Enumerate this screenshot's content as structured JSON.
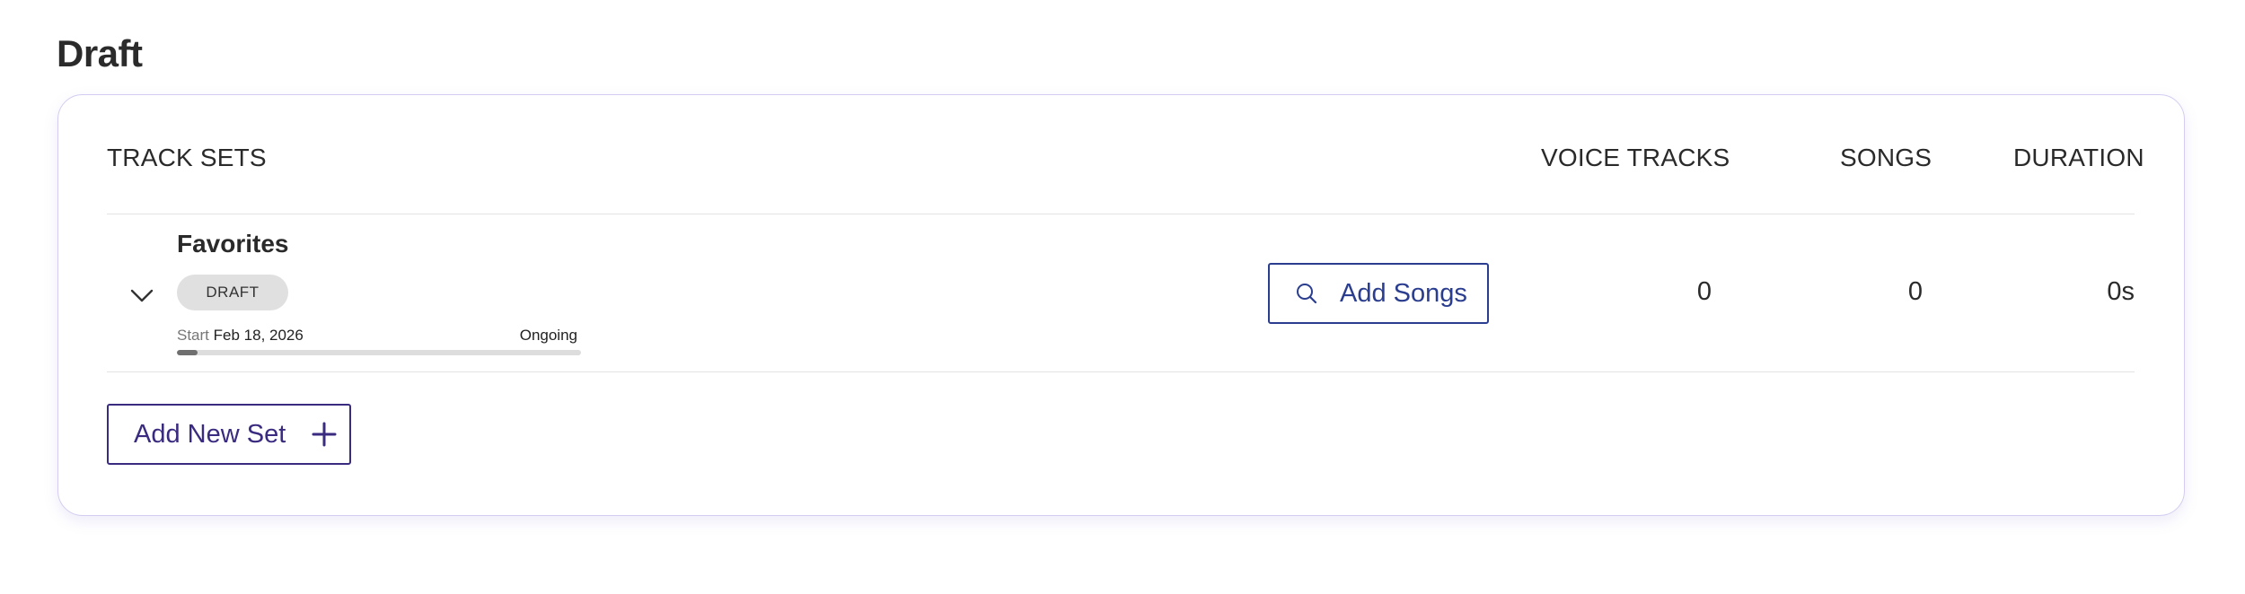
{
  "page": {
    "title": "Draft"
  },
  "table": {
    "headers": {
      "track_sets": "TRACK SETS",
      "voice_tracks": "VOICE TRACKS",
      "songs": "SONGS",
      "duration": "DURATION"
    },
    "rows": [
      {
        "name": "Favorites",
        "status": "DRAFT",
        "start_label": "Start",
        "start_date": "Feb 18, 2026",
        "end_label": "Ongoing",
        "progress_fraction": 0.05,
        "add_songs_label": "Add Songs",
        "voice_tracks": "0",
        "songs": "0",
        "duration": "0s"
      }
    ]
  },
  "actions": {
    "add_new_set_label": "Add New Set"
  },
  "icons": {
    "expand": "chevron-down-icon",
    "search": "search-icon",
    "add": "plus-icon"
  },
  "colors": {
    "card_border": "#d4ccf1",
    "add_songs_accent": "#2a3d8f",
    "add_set_accent": "#3a2a80",
    "badge_bg": "#e0e0e0",
    "progress_fill": "#6f6f6f"
  }
}
